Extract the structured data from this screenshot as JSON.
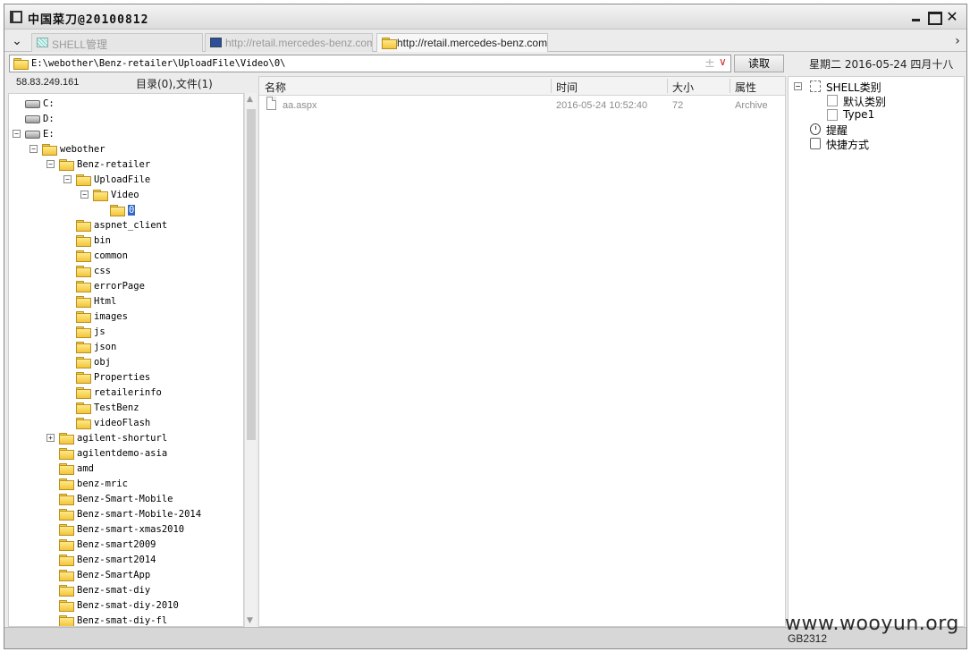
{
  "window": {
    "title": "中国菜刀@20100812"
  },
  "tabs": [
    {
      "label": "SHELL管理",
      "active": false
    },
    {
      "label": "http://retail.mercedes-benz.com....",
      "active": false
    },
    {
      "label": "http://retail.mercedes-benz.com....",
      "active": true
    }
  ],
  "pathbar": {
    "path": "E:\\webother\\Benz-retailer\\UploadFile\\Video\\0\\",
    "read_button": "读取"
  },
  "date_text": "星期二 2016-05-24 四月十八",
  "info": {
    "ip": "58.83.249.161",
    "counts": "目录(0),文件(1)"
  },
  "tree": [
    {
      "label": "C:",
      "type": "drive",
      "depth": 0,
      "expander": ""
    },
    {
      "label": "D:",
      "type": "drive",
      "depth": 0,
      "expander": ""
    },
    {
      "label": "E:",
      "type": "drive",
      "depth": 0,
      "expander": "−"
    },
    {
      "label": "webother",
      "type": "folder",
      "depth": 1,
      "expander": "−"
    },
    {
      "label": "Benz-retailer",
      "type": "folder",
      "depth": 2,
      "expander": "−"
    },
    {
      "label": "UploadFile",
      "type": "folder",
      "depth": 3,
      "expander": "−"
    },
    {
      "label": "Video",
      "type": "folder",
      "depth": 4,
      "expander": "−"
    },
    {
      "label": "0",
      "type": "folder",
      "depth": 5,
      "expander": "",
      "selected": true
    },
    {
      "label": "aspnet_client",
      "type": "folder",
      "depth": 3,
      "expander": ""
    },
    {
      "label": "bin",
      "type": "folder",
      "depth": 3,
      "expander": ""
    },
    {
      "label": "common",
      "type": "folder",
      "depth": 3,
      "expander": ""
    },
    {
      "label": "css",
      "type": "folder",
      "depth": 3,
      "expander": ""
    },
    {
      "label": "errorPage",
      "type": "folder",
      "depth": 3,
      "expander": ""
    },
    {
      "label": "Html",
      "type": "folder",
      "depth": 3,
      "expander": ""
    },
    {
      "label": "images",
      "type": "folder",
      "depth": 3,
      "expander": ""
    },
    {
      "label": "js",
      "type": "folder",
      "depth": 3,
      "expander": ""
    },
    {
      "label": "json",
      "type": "folder",
      "depth": 3,
      "expander": ""
    },
    {
      "label": "obj",
      "type": "folder",
      "depth": 3,
      "expander": ""
    },
    {
      "label": "Properties",
      "type": "folder",
      "depth": 3,
      "expander": ""
    },
    {
      "label": "retailerinfo",
      "type": "folder",
      "depth": 3,
      "expander": ""
    },
    {
      "label": "TestBenz",
      "type": "folder",
      "depth": 3,
      "expander": ""
    },
    {
      "label": "videoFlash",
      "type": "folder",
      "depth": 3,
      "expander": ""
    },
    {
      "label": "agilent-shorturl",
      "type": "folder",
      "depth": 2,
      "expander": "+"
    },
    {
      "label": "agilentdemo-asia",
      "type": "folder",
      "depth": 2,
      "expander": ""
    },
    {
      "label": "amd",
      "type": "folder",
      "depth": 2,
      "expander": ""
    },
    {
      "label": "benz-mric",
      "type": "folder",
      "depth": 2,
      "expander": ""
    },
    {
      "label": "Benz-Smart-Mobile",
      "type": "folder",
      "depth": 2,
      "expander": ""
    },
    {
      "label": "Benz-smart-Mobile-2014",
      "type": "folder",
      "depth": 2,
      "expander": ""
    },
    {
      "label": "Benz-smart-xmas2010",
      "type": "folder",
      "depth": 2,
      "expander": ""
    },
    {
      "label": "Benz-smart2009",
      "type": "folder",
      "depth": 2,
      "expander": ""
    },
    {
      "label": "Benz-smart2014",
      "type": "folder",
      "depth": 2,
      "expander": ""
    },
    {
      "label": "Benz-SmartApp",
      "type": "folder",
      "depth": 2,
      "expander": ""
    },
    {
      "label": "Benz-smat-diy",
      "type": "folder",
      "depth": 2,
      "expander": ""
    },
    {
      "label": "Benz-smat-diy-2010",
      "type": "folder",
      "depth": 2,
      "expander": ""
    },
    {
      "label": "Benz-smat-diy-fl",
      "type": "folder",
      "depth": 2,
      "expander": ""
    }
  ],
  "file_list": {
    "columns": [
      "名称",
      "时间",
      "大小",
      "属性"
    ],
    "rows": [
      {
        "name": "aa.aspx",
        "time": "2016-05-24 10:52:40",
        "size": "72",
        "attr": "Archive"
      }
    ]
  },
  "right_tree": [
    {
      "label": "SHELL类别",
      "icon": "shell",
      "depth": 0,
      "expander": "−"
    },
    {
      "label": "默认类别",
      "icon": "doc",
      "depth": 1,
      "expander": ""
    },
    {
      "label": "Type1",
      "icon": "doc",
      "depth": 1,
      "expander": ""
    },
    {
      "label": "提醒",
      "icon": "clock",
      "depth": 0,
      "expander": ""
    },
    {
      "label": "快捷方式",
      "icon": "shortcut",
      "depth": 0,
      "expander": ""
    }
  ],
  "status": {
    "encoding": "GB2312"
  },
  "watermark": "www.wooyun.org"
}
